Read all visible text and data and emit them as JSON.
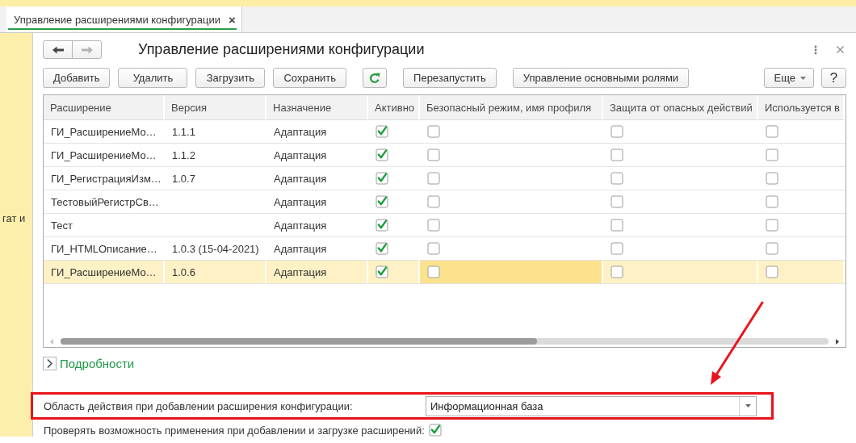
{
  "tabs": [
    {
      "label": "Управление расширениями конфигурации",
      "close": "×",
      "selected": true
    }
  ],
  "sidebar": {
    "text": "гат и"
  },
  "form": {
    "nav": [
      {
        "kind": "back",
        "disabled": false
      },
      {
        "kind": "forward",
        "disabled": true
      }
    ],
    "title": "Управление расширениями конфигурации",
    "toolbar": {
      "groups": [
        [
          {
            "kind": "button",
            "label": "Добавить"
          },
          {
            "kind": "button",
            "label": "Удалить"
          },
          {
            "kind": "button",
            "label": "Загрузить"
          },
          {
            "kind": "button",
            "label": "Сохранить"
          }
        ],
        [
          {
            "kind": "refresh"
          }
        ],
        [
          {
            "kind": "button",
            "label": "Перезапустить"
          }
        ],
        [
          {
            "kind": "button",
            "label": "Управление основными ролями"
          }
        ]
      ],
      "right": [
        {
          "kind": "menu",
          "label": "Еще"
        },
        {
          "kind": "help",
          "label": "?"
        }
      ]
    },
    "table": {
      "columns": [
        "Расширение",
        "Версия",
        "Назначение",
        "Активно",
        "Безопасный режим, имя профиля",
        "Защита от опасных действий",
        "Используется в"
      ],
      "rows": [
        {
          "name": "ГИ_РасширениеМо…",
          "version": "1.1.1",
          "purpose": "Адаптация",
          "selected": false,
          "flags": [
            {
              "checked": true,
              "focused": false
            },
            {
              "checked": false,
              "focused": false
            },
            {
              "checked": false,
              "focused": false
            },
            {
              "checked": false,
              "focused": false
            }
          ]
        },
        {
          "name": "ГИ_РасширениеМо…",
          "version": "1.1.2",
          "purpose": "Адаптация",
          "selected": false,
          "flags": [
            {
              "checked": true,
              "focused": false
            },
            {
              "checked": false,
              "focused": false
            },
            {
              "checked": false,
              "focused": false
            },
            {
              "checked": false,
              "focused": false
            }
          ]
        },
        {
          "name": "ГИ_РегистрацияИзм…",
          "version": "1.0.7",
          "purpose": "Адаптация",
          "selected": false,
          "flags": [
            {
              "checked": true,
              "focused": false
            },
            {
              "checked": false,
              "focused": false
            },
            {
              "checked": false,
              "focused": false
            },
            {
              "checked": false,
              "focused": false
            }
          ]
        },
        {
          "name": "ТестовыйРегистрСв…",
          "purpose": "Адаптация",
          "selected": false,
          "flags": [
            {
              "checked": true,
              "focused": false
            },
            {
              "checked": false,
              "focused": false
            },
            {
              "checked": false,
              "focused": false
            },
            {
              "checked": false,
              "focused": false
            }
          ]
        },
        {
          "name": "Тест",
          "purpose": "Адаптация",
          "selected": false,
          "flags": [
            {
              "checked": true,
              "focused": false
            },
            {
              "checked": false,
              "focused": false
            },
            {
              "checked": false,
              "focused": false
            },
            {
              "checked": false,
              "focused": false
            }
          ]
        },
        {
          "name": "ГИ_HTMLОписание…",
          "version": "1.0.3 (15-04-2021)",
          "purpose": "Адаптация",
          "selected": false,
          "flags": [
            {
              "checked": true,
              "focused": false
            },
            {
              "checked": false,
              "focused": false
            },
            {
              "checked": false,
              "focused": false
            },
            {
              "checked": false,
              "focused": false
            }
          ]
        },
        {
          "name": "ГИ_РасширениеМо…",
          "version": "1.0.6",
          "purpose": "Адаптация",
          "selected": true,
          "flags": [
            {
              "checked": true,
              "focused": false
            },
            {
              "checked": false,
              "focused": true
            },
            {
              "checked": false,
              "focused": false
            },
            {
              "checked": false,
              "focused": false
            }
          ]
        }
      ]
    },
    "details": {
      "label": "Подробности",
      "expanded": false
    },
    "scope": {
      "label": "Область действия при добавлении расширения конфигурации:",
      "value": "Информационная база",
      "highlighted": true
    },
    "check": {
      "label": "Проверять возможность применения при добавлении и загрузке расширений:",
      "checked": true
    }
  },
  "annotations": [
    {
      "kind": "arrow"
    }
  ]
}
